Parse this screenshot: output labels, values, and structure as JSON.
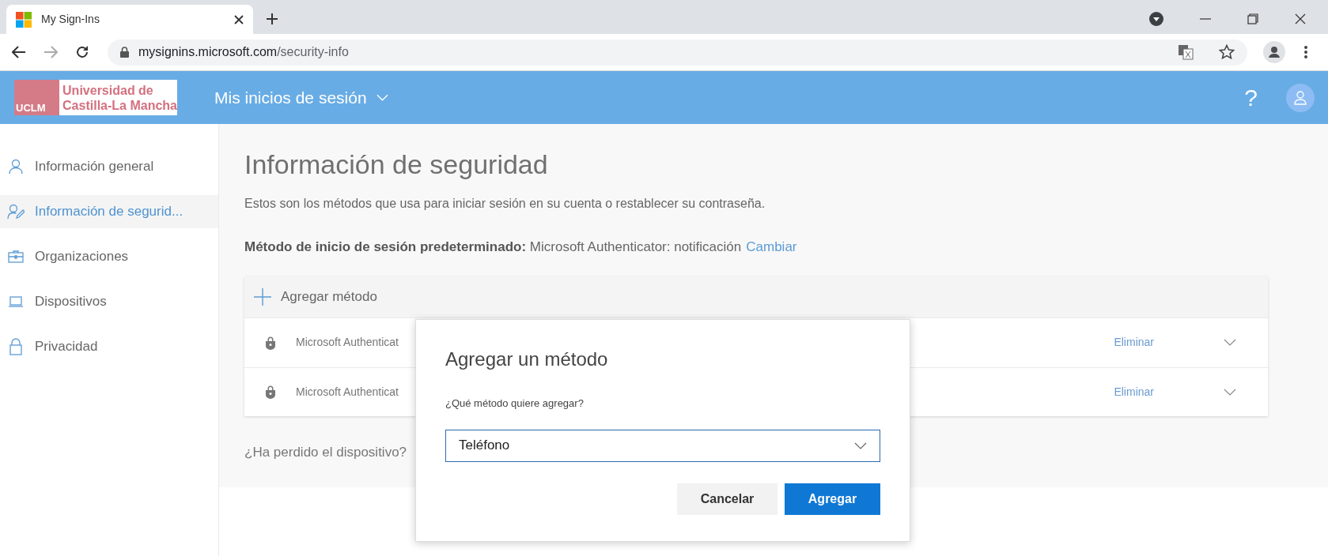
{
  "browser": {
    "tab_title": "My Sign-Ins",
    "url_host": "mysignins.microsoft.com",
    "url_path": "/security-info"
  },
  "header": {
    "logo_line1": "Universidad de",
    "logo_line2": "Castilla-La Mancha",
    "logo_mark": "UCLM",
    "app_title": "Mis inicios de sesión",
    "help": "?"
  },
  "sidebar": {
    "items": [
      {
        "label": "Información general",
        "selected": false
      },
      {
        "label": "Información de segurid...",
        "selected": true
      },
      {
        "label": "Organizaciones",
        "selected": false
      },
      {
        "label": "Dispositivos",
        "selected": false
      },
      {
        "label": "Privacidad",
        "selected": false
      }
    ]
  },
  "content": {
    "title": "Información de seguridad",
    "subtitle": "Estos son los métodos que usa para iniciar sesión en su cuenta o restablecer su contraseña.",
    "default_label": "Método de inicio de sesión predeterminado:",
    "default_value": "Microsoft Authenticator: notificación",
    "change_link": "Cambiar",
    "add_method": "Agregar método",
    "methods": [
      {
        "name": "Microsoft Authenticat",
        "action": "Eliminar"
      },
      {
        "name": "Microsoft Authenticat",
        "action": "Eliminar"
      }
    ],
    "lost_device": "¿Ha perdido el dispositivo?"
  },
  "dialog": {
    "title": "Agregar un método",
    "question": "¿Qué método quiere agregar?",
    "select_value": "Teléfono",
    "cancel": "Cancelar",
    "confirm": "Agregar"
  }
}
